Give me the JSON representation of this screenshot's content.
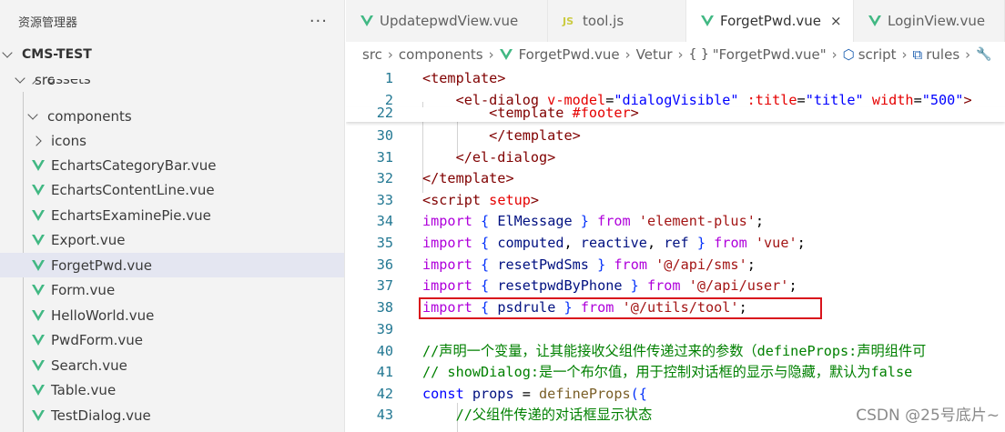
{
  "sidebar": {
    "title": "资源管理器",
    "more": "···",
    "project": "CMS-TEST",
    "folders": {
      "src": "src",
      "assets": "assets",
      "components": "components",
      "icons": "icons"
    },
    "files": [
      "EchartsCategoryBar.vue",
      "EchartsContentLine.vue",
      "EchartsExaminePie.vue",
      "Export.vue",
      "ForgetPwd.vue",
      "Form.vue",
      "HelloWorld.vue",
      "PwdForm.vue",
      "Search.vue",
      "Table.vue",
      "TestDialog.vue"
    ],
    "selected_file": "ForgetPwd.vue"
  },
  "tabs": [
    {
      "label": "UpdatepwdView.vue",
      "icon": "vue-icon"
    },
    {
      "label": "tool.js",
      "icon": "js-icon",
      "icon_text": "JS"
    },
    {
      "label": "ForgetPwd.vue",
      "icon": "vue-icon",
      "active": true,
      "close": "×"
    },
    {
      "label": "LoginView.vue",
      "icon": "vue-icon"
    }
  ],
  "breadcrumb": {
    "src": "src",
    "components": "components",
    "file": "ForgetPwd.vue",
    "vetur": "Vetur",
    "braces": "{ }",
    "quoted": "\"ForgetPwd.vue\"",
    "script": "script",
    "rules": "rules"
  },
  "editor": {
    "lines": [
      {
        "n": "1",
        "text": "<template>"
      },
      {
        "n": "2",
        "text": "    <el-dialog v-model=\"dialogVisible\" :title=\"title\" width=\"500\">"
      },
      {
        "n": "22",
        "text": "        <template #footer>"
      },
      {
        "n": "30",
        "text": "        </template>"
      },
      {
        "n": "31",
        "text": "    </el-dialog>"
      },
      {
        "n": "32",
        "text": "</template>"
      },
      {
        "n": "33",
        "text": "<script setup>"
      },
      {
        "n": "34",
        "text": "import { ElMessage } from 'element-plus';"
      },
      {
        "n": "35",
        "text": "import { computed, reactive, ref } from 'vue';"
      },
      {
        "n": "36",
        "text": "import { resetPwdSms } from '@/api/sms';"
      },
      {
        "n": "37",
        "text": "import { resetpwdByPhone } from '@/api/user';"
      },
      {
        "n": "38",
        "text": "import { psdrule } from '@/utils/tool';"
      },
      {
        "n": "39",
        "text": ""
      },
      {
        "n": "40",
        "text": "//声明一个变量，让其能接收父组件传递过来的参数（defineProps:声明组件可"
      },
      {
        "n": "41",
        "text": "// showDialog:是一个布尔值，用于控制对话框的显示与隐藏，默认为false"
      },
      {
        "n": "42",
        "text": "const props = defineProps({"
      },
      {
        "n": "43",
        "text": "    //父组件传递的对话框显示状态"
      }
    ],
    "highlighted_line": "38",
    "colors": {
      "highlight_border": "#d9141c",
      "line_number": "#237893"
    }
  },
  "watermark": "CSDN @25号底片~"
}
